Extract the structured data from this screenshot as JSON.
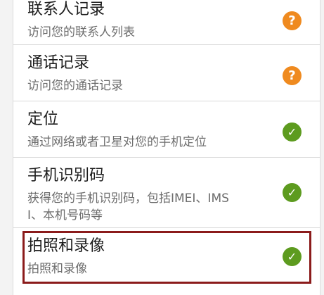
{
  "permissions": [
    {
      "title": "联系人记录",
      "description": "访问您的联系人列表",
      "status": "ask",
      "icon": "question-icon"
    },
    {
      "title": "通话记录",
      "description": "访问您的通话记录",
      "status": "ask",
      "icon": "question-icon"
    },
    {
      "title": "定位",
      "description": "通过网络或者卫星对您的手机定位",
      "status": "allowed",
      "icon": "check-icon"
    },
    {
      "title": "手机识别码",
      "description": "获得您的手机识别码，包括IMEI、IMSI、本机号码等",
      "status": "allowed",
      "icon": "check-icon"
    },
    {
      "title": "拍照和录像",
      "description": "拍照和录像",
      "status": "allowed",
      "icon": "check-icon"
    }
  ],
  "icons": {
    "question": "?",
    "check": "✓"
  },
  "colors": {
    "ask": "#ef8a1f",
    "allowed": "#5d9b1f",
    "highlight_border": "#8b1b1b"
  }
}
